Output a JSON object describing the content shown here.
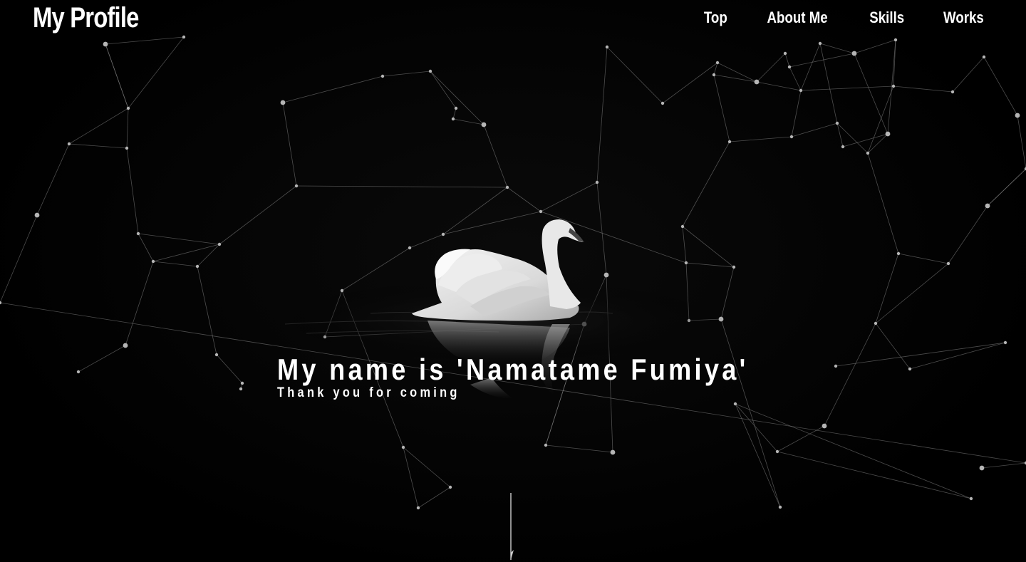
{
  "header": {
    "logo": "My Profile",
    "nav": [
      {
        "label": "Top"
      },
      {
        "label": "About Me"
      },
      {
        "label": "Skills"
      },
      {
        "label": "Works"
      }
    ]
  },
  "hero": {
    "title": "My name is 'Namatame Fumiya'",
    "subtitle": "Thank you for coming"
  },
  "colors": {
    "background": "#000000",
    "text": "#ffffff",
    "network_line": "#8a8a8a",
    "network_node": "#b5b5b5"
  },
  "icons": {
    "scroll": "scroll-down-arrow-icon",
    "background": "swan-on-dark-water",
    "overlay": "particle-network"
  }
}
